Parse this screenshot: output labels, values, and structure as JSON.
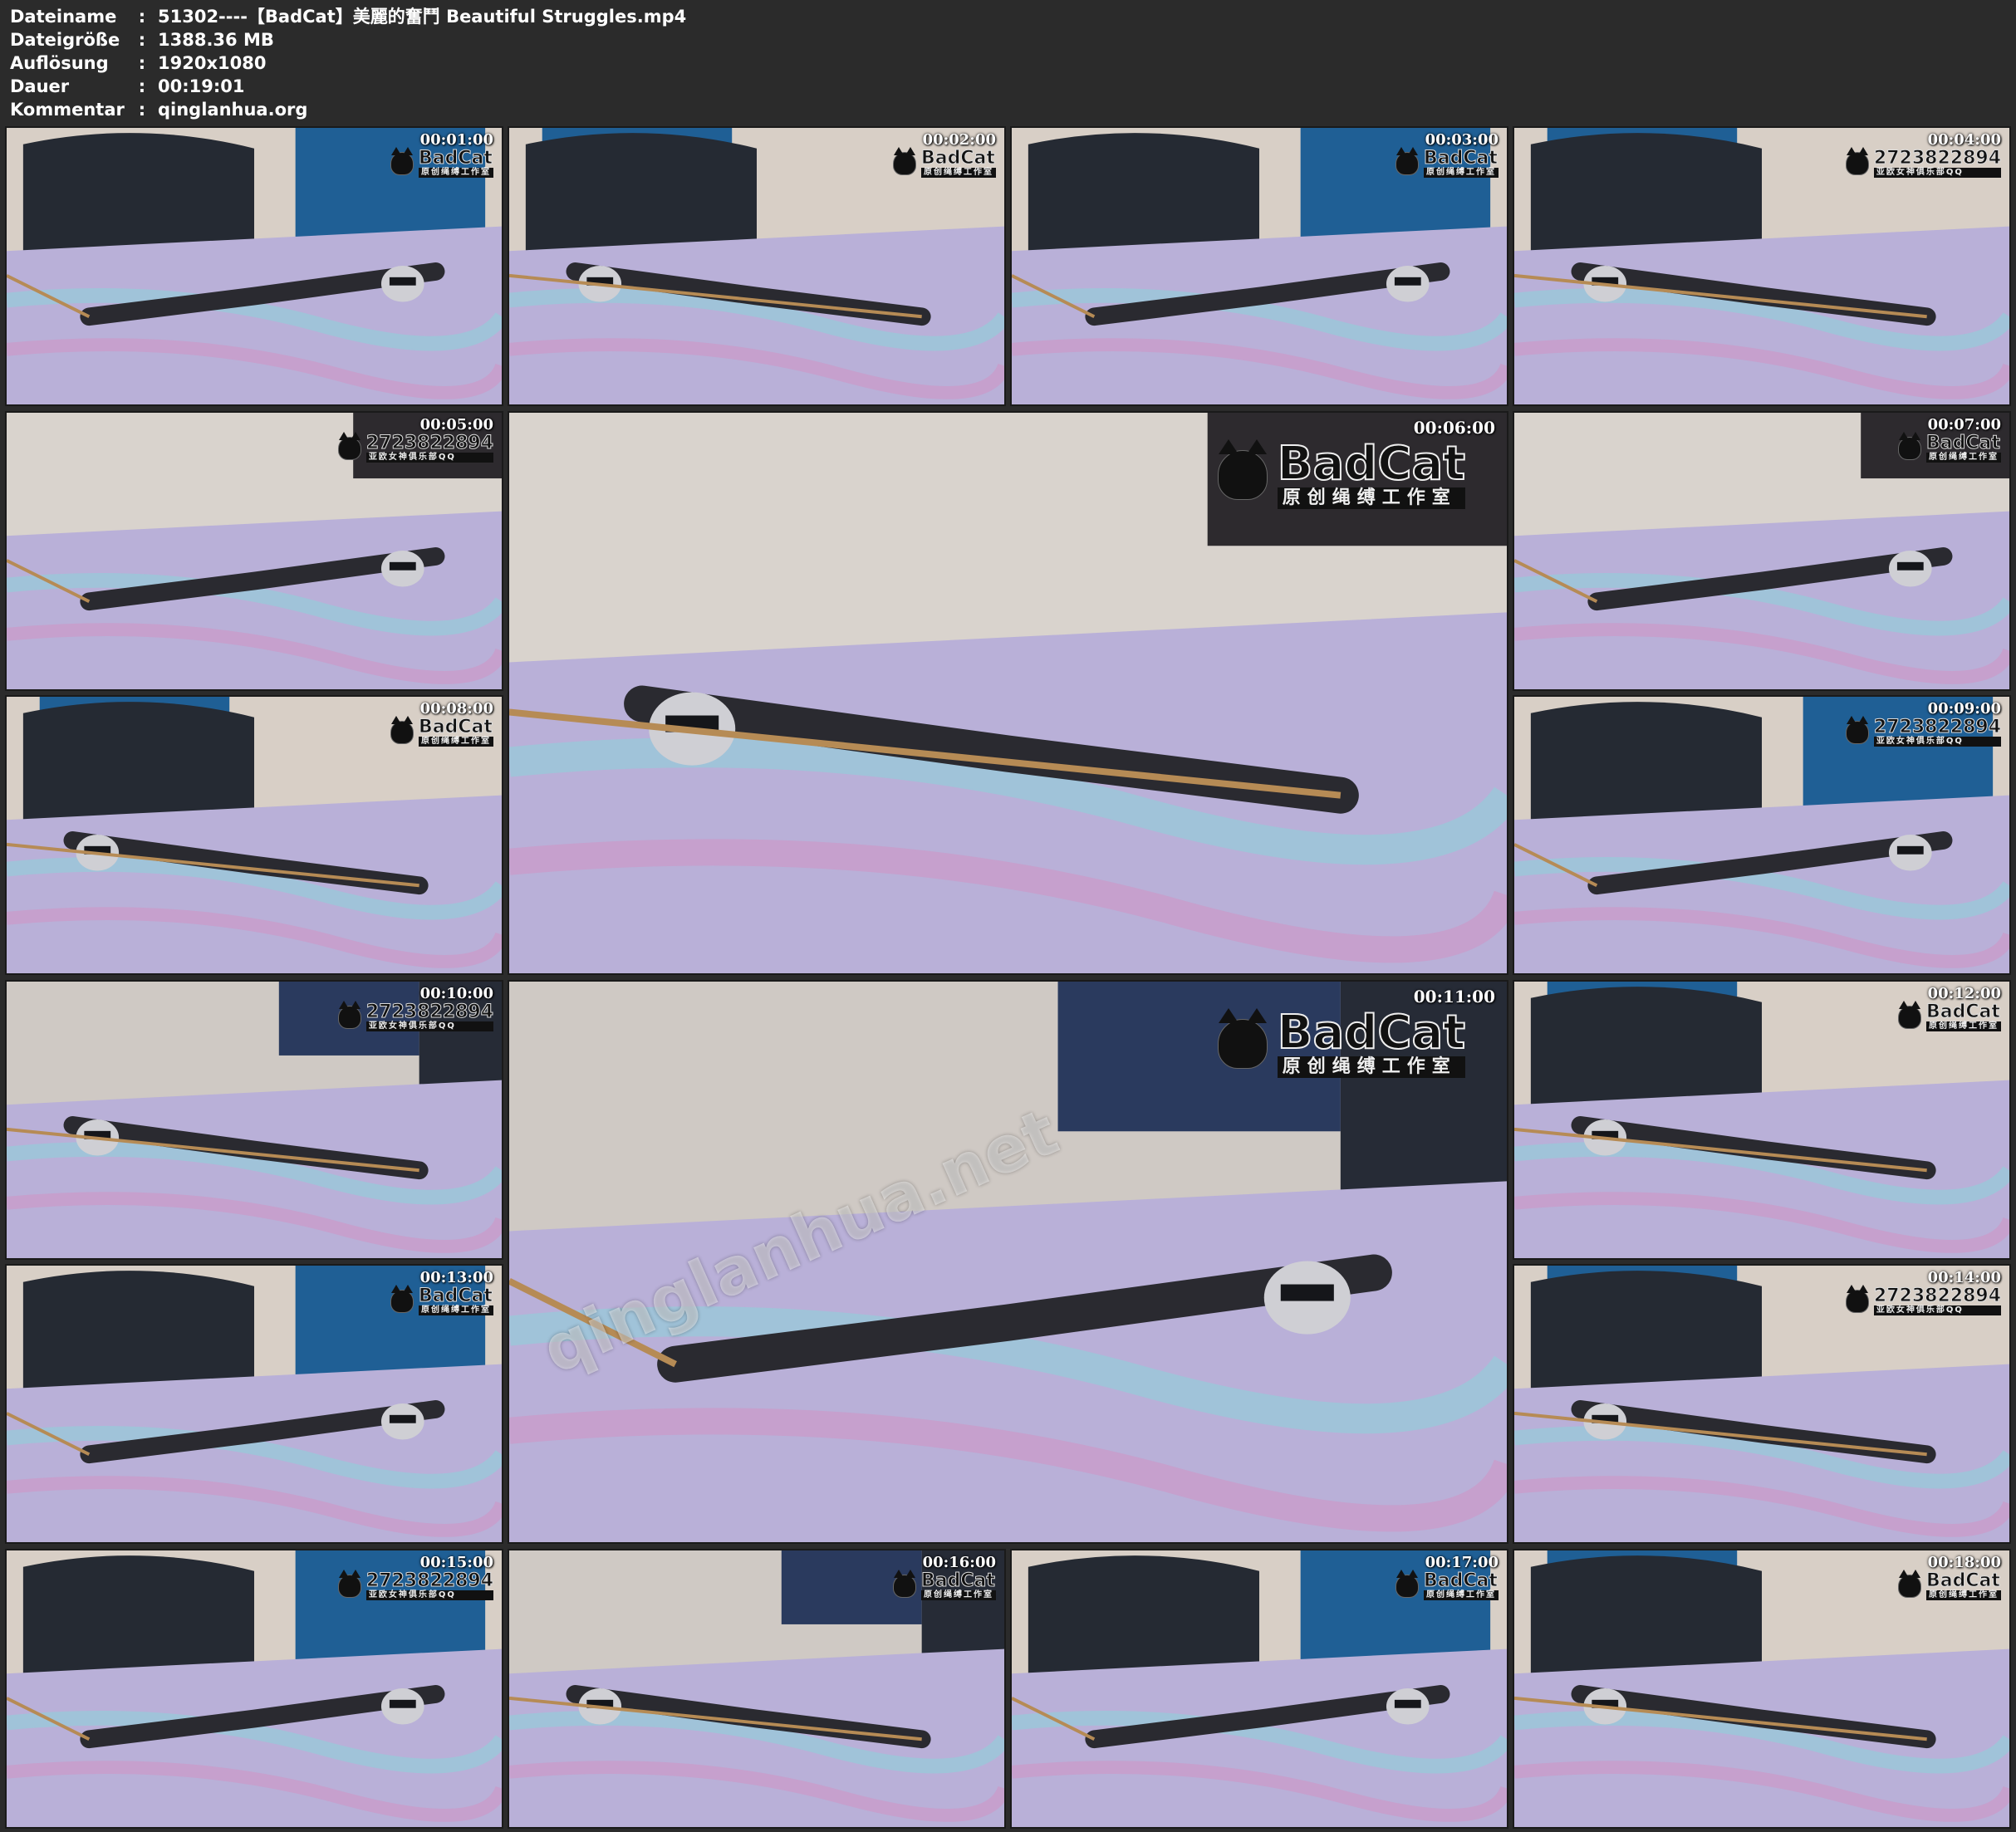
{
  "file_info": {
    "rows": [
      {
        "key": "Dateiname",
        "sep": ":",
        "value": "51302----【BadCat】美麗的奮鬥 Beautiful Struggles.mp4"
      },
      {
        "key": "Dateigröße",
        "sep": ":",
        "value": "1388.36 MB"
      },
      {
        "key": "Auflösung",
        "sep": ":",
        "value": "1920x1080"
      },
      {
        "key": "Dauer",
        "sep": ":",
        "value": "00:19:01"
      },
      {
        "key": "Kommentar",
        "sep": ":",
        "value": "qinglanhua.org"
      }
    ]
  },
  "thumbnails": [
    {
      "time": "00:01:00",
      "brand": "BadCat",
      "sub": "原创绳缚工作室",
      "scene": "headboard"
    },
    {
      "time": "00:02:00",
      "brand": "BadCat",
      "sub": "原创绳缚工作室",
      "scene": "headboard"
    },
    {
      "time": "00:03:00",
      "brand": "BadCat",
      "sub": "原创绳缚工作室",
      "scene": "headboard"
    },
    {
      "time": "00:04:00",
      "brand": "2723822894",
      "sub": "亚欧女神俱乐部QQ",
      "scene": "headboard"
    },
    {
      "time": "00:05:00",
      "brand": "2723822894",
      "sub": "亚欧女神俱乐部QQ",
      "scene": "close"
    },
    {
      "time": "00:06:00",
      "brand": "BadCat",
      "sub": "原创绳缚工作室",
      "scene": "close"
    },
    {
      "time": "00:07:00",
      "brand": "BadCat",
      "sub": "原创绳缚工作室",
      "scene": "close"
    },
    {
      "time": "00:08:00",
      "brand": "BadCat",
      "sub": "原创绳缚工作室",
      "scene": "headboard"
    },
    {
      "time": "00:09:00",
      "brand": "2723822894",
      "sub": "亚欧女神俱乐部QQ",
      "scene": "headboard"
    },
    {
      "time": "00:10:00",
      "brand": "2723822894",
      "sub": "亚欧女神俱乐部QQ",
      "scene": "room"
    },
    {
      "time": "00:11:00",
      "brand": "BadCat",
      "sub": "原创绳缚工作室",
      "scene": "room"
    },
    {
      "time": "00:12:00",
      "brand": "BadCat",
      "sub": "原创绳缚工作室",
      "scene": "headboard"
    },
    {
      "time": "00:13:00",
      "brand": "BadCat",
      "sub": "原创绳缚工作室",
      "scene": "headboard"
    },
    {
      "time": "00:14:00",
      "brand": "2723822894",
      "sub": "亚欧女神俱乐部QQ",
      "scene": "headboard"
    },
    {
      "time": "00:15:00",
      "brand": "2723822894",
      "sub": "亚欧女神俱乐部QQ",
      "scene": "headboard"
    },
    {
      "time": "00:16:00",
      "brand": "BadCat",
      "sub": "原创绳缚工作室",
      "scene": "room"
    },
    {
      "time": "00:17:00",
      "brand": "BadCat",
      "sub": "原创绳缚工作室",
      "scene": "headboard"
    },
    {
      "time": "00:18:00",
      "brand": "BadCat",
      "sub": "原创绳缚工作室",
      "scene": "headboard"
    }
  ],
  "overlay_watermark": "qinglanhua.net",
  "colors": {
    "background": "#2b2b2b",
    "header_text": "#ffffff",
    "curtain": "#1f5f95",
    "sheet": "#b9b0d8",
    "headboard": "#252a33"
  }
}
